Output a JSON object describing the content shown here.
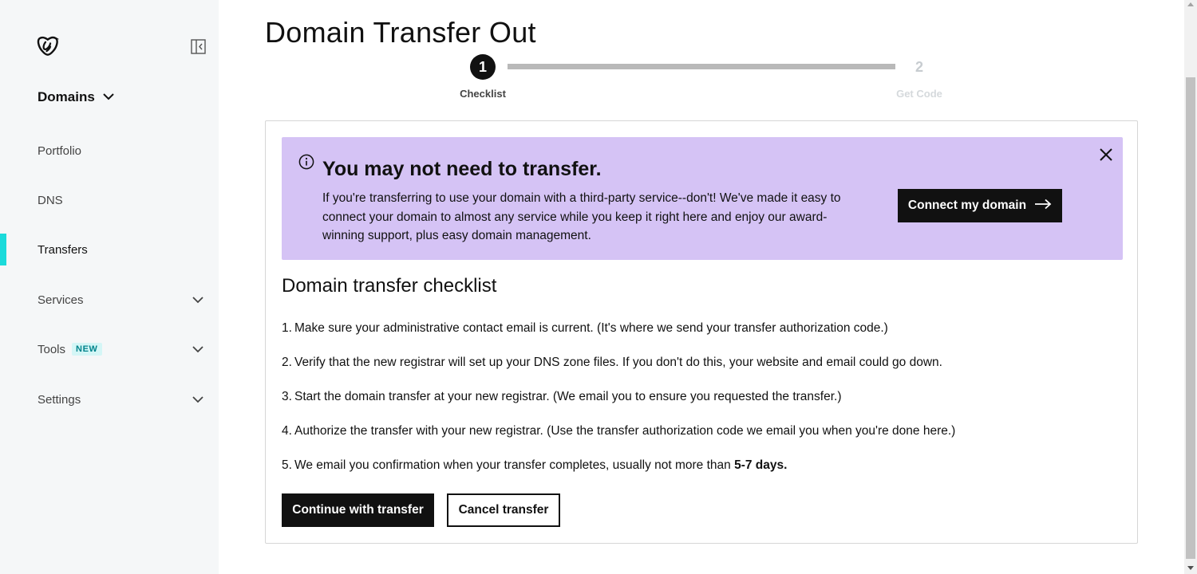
{
  "sidebar": {
    "logo_icon": "godaddy-logo-icon",
    "collapse_icon": "sidebar-collapse-icon",
    "section": {
      "label": "Domains",
      "icon": "chevron-down-icon"
    },
    "items": [
      {
        "label": "Portfolio",
        "active": false
      },
      {
        "label": "DNS",
        "active": false
      },
      {
        "label": "Transfers",
        "active": true
      },
      {
        "label": "Services",
        "active": false,
        "expandable": true
      },
      {
        "label": "Tools",
        "badge": "NEW",
        "active": false,
        "expandable": true
      },
      {
        "label": "Settings",
        "active": false,
        "expandable": true
      }
    ],
    "active_color": "#1bdbdb"
  },
  "main": {
    "title": "Domain Transfer Out",
    "stepper": {
      "steps": [
        {
          "number": "1",
          "label": "Checklist",
          "state": "current"
        },
        {
          "number": "2",
          "label": "Get Code",
          "state": "upcoming"
        }
      ]
    },
    "alert": {
      "icon": "info-icon",
      "title": "You may not need to transfer.",
      "body": "If you're transferring to use your domain with a third-party service--don't! We've made it easy to connect your domain to almost any service while you keep it right here and enjoy our award-winning support, plus easy domain management.",
      "button_label": "Connect my domain",
      "button_icon": "arrow-right-icon",
      "close_icon": "close-icon",
      "background": "#d5c3f5"
    },
    "checklist": {
      "title": "Domain transfer checklist",
      "items": [
        {
          "num": "1.",
          "text": "Make sure your administrative contact email is current. (It's where we send your transfer authorization code.)"
        },
        {
          "num": "2.",
          "text": "Verify that the new registrar will set up your DNS zone files. If you don't do this, your website and email could go down."
        },
        {
          "num": "3.",
          "text": "Start the domain transfer at your new registrar. (We email you to ensure you requested the transfer.)"
        },
        {
          "num": "4.",
          "text": "Authorize the transfer with your new registrar. (Use the transfer authorization code we email you when you're done here.)"
        },
        {
          "num": "5.",
          "text": "We email you confirmation when your transfer completes, usually not more than ",
          "bold": "5-7 days",
          "suffix": "."
        }
      ]
    },
    "buttons": {
      "continue_label": "Continue with transfer",
      "cancel_label": "Cancel transfer"
    }
  }
}
